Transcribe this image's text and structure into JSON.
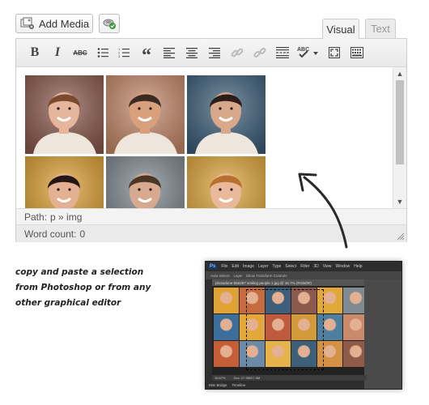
{
  "media_button": {
    "label": "Add Media",
    "icon": "media-icon"
  },
  "plugin_button": {
    "icon": "plugin-icon"
  },
  "tabs": {
    "visual": "Visual",
    "text": "Text"
  },
  "toolbar": {
    "buttons": [
      "bold-icon",
      "italic-icon",
      "strikethrough-icon",
      "bullet-list-icon",
      "numbered-list-icon",
      "blockquote-icon",
      "align-left-icon",
      "align-center-icon",
      "align-right-icon",
      "link-icon",
      "unlink-icon",
      "read-more-icon",
      "spellcheck-icon",
      "fullscreen-icon",
      "kitchen-sink-icon"
    ],
    "bold": "B",
    "italic": "I",
    "strike": "ABC",
    "quote": "“",
    "spell": "ABC"
  },
  "editor": {
    "path_label": "Path:",
    "path_value": "p » img",
    "wordcount_label": "Word count:",
    "wordcount_value": "0"
  },
  "photos": [
    {
      "bg": "#8c5a4c",
      "skin": "#e6b69c",
      "hair": "#7a4a30"
    },
    {
      "bg": "#c88a6a",
      "skin": "#d9a07e",
      "hair": "#3a2a22"
    },
    {
      "bg": "#3d5f7a",
      "skin": "#d7a88a",
      "hair": "#2b1e18"
    },
    {
      "bg": "#e0a233",
      "skin": "#e4b092",
      "hair": "#241612"
    },
    {
      "bg": "#7f8a92",
      "skin": "#d7a98e",
      "hair": "#4a3526"
    },
    {
      "bg": "#e2a83a",
      "skin": "#eab89a",
      "hair": "#b8702e"
    }
  ],
  "caption": {
    "line1": "copy and paste a selection",
    "line2": "from Photoshop or from any",
    "line3": "other graphical editor"
  },
  "photoshop": {
    "logo": "Ps",
    "menu": [
      "File",
      "Edit",
      "Image",
      "Layer",
      "Type",
      "Select",
      "Filter",
      "3D",
      "View",
      "Window",
      "Help"
    ],
    "options": [
      "Auto-Select:",
      "Layer",
      "Show Transform Controls"
    ],
    "doc_tab": "photodune-555287 smiling people 1.jpg @ 16.7% (RGB/8#)",
    "status_zoom": "16.67%",
    "status_doc": "Doc: 27.9M/27.9M",
    "bottom": [
      "Mini Bridge",
      "Timeline"
    ],
    "tile_colors": [
      "#e0a233",
      "#c66b3e",
      "#3d5f7a",
      "#8c5a4c",
      "#e2a83a",
      "#7f8a92",
      "#3b6e9a",
      "#e2a83a",
      "#c05a3e",
      "#d39a3a",
      "#4f7f9e",
      "#c88a6a",
      "#c45e36",
      "#6a8aa8",
      "#e6b24a",
      "#3d5f7a",
      "#d49043",
      "#8f5a48"
    ]
  },
  "colors": {
    "accent": "#e14d43",
    "toolbar_bg": "#f3f3f3",
    "border": "#cccccc"
  }
}
